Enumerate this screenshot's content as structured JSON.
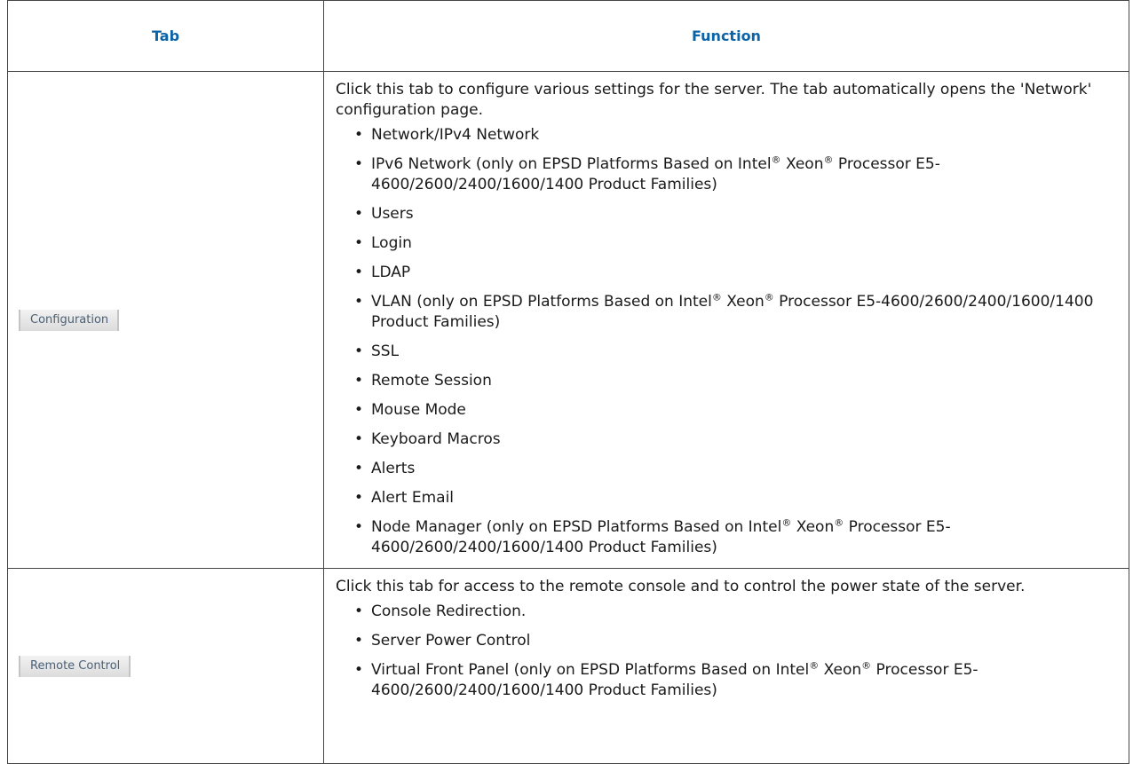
{
  "table": {
    "headers": {
      "tab": "Tab",
      "function": "Function"
    },
    "rows": [
      {
        "tab_button": "Configuration",
        "description": "Click this tab to configure various settings for the server. The tab automatically opens the 'Network' configuration page.",
        "items": [
          "Network/IPv4 Network",
          "IPv6 Network (only on EPSD Platforms Based on Intel® Xeon® Processor E5-4600/2600/2400/1600/1400 Product Families)",
          "Users",
          "Login",
          "LDAP",
          "VLAN (only on EPSD Platforms Based on Intel® Xeon® Processor E5-4600/2600/2400/1600/1400 Product Families)",
          "SSL",
          "Remote Session",
          "Mouse Mode",
          "Keyboard Macros",
          "Alerts",
          "Alert Email",
          "Node Manager (only on EPSD Platforms Based on Intel® Xeon® Processor E5-4600/2600/2400/1600/1400 Product Families)"
        ]
      },
      {
        "tab_button": "Remote Control",
        "description": "Click this tab for access to the remote console and to control the power state of the server.",
        "items": [
          "Console Redirection.",
          "Server Power Control",
          "Virtual Front Panel (only on EPSD Platforms Based on Intel® Xeon® Processor E5-4600/2600/2400/1600/1400 Product Families)"
        ]
      }
    ]
  }
}
